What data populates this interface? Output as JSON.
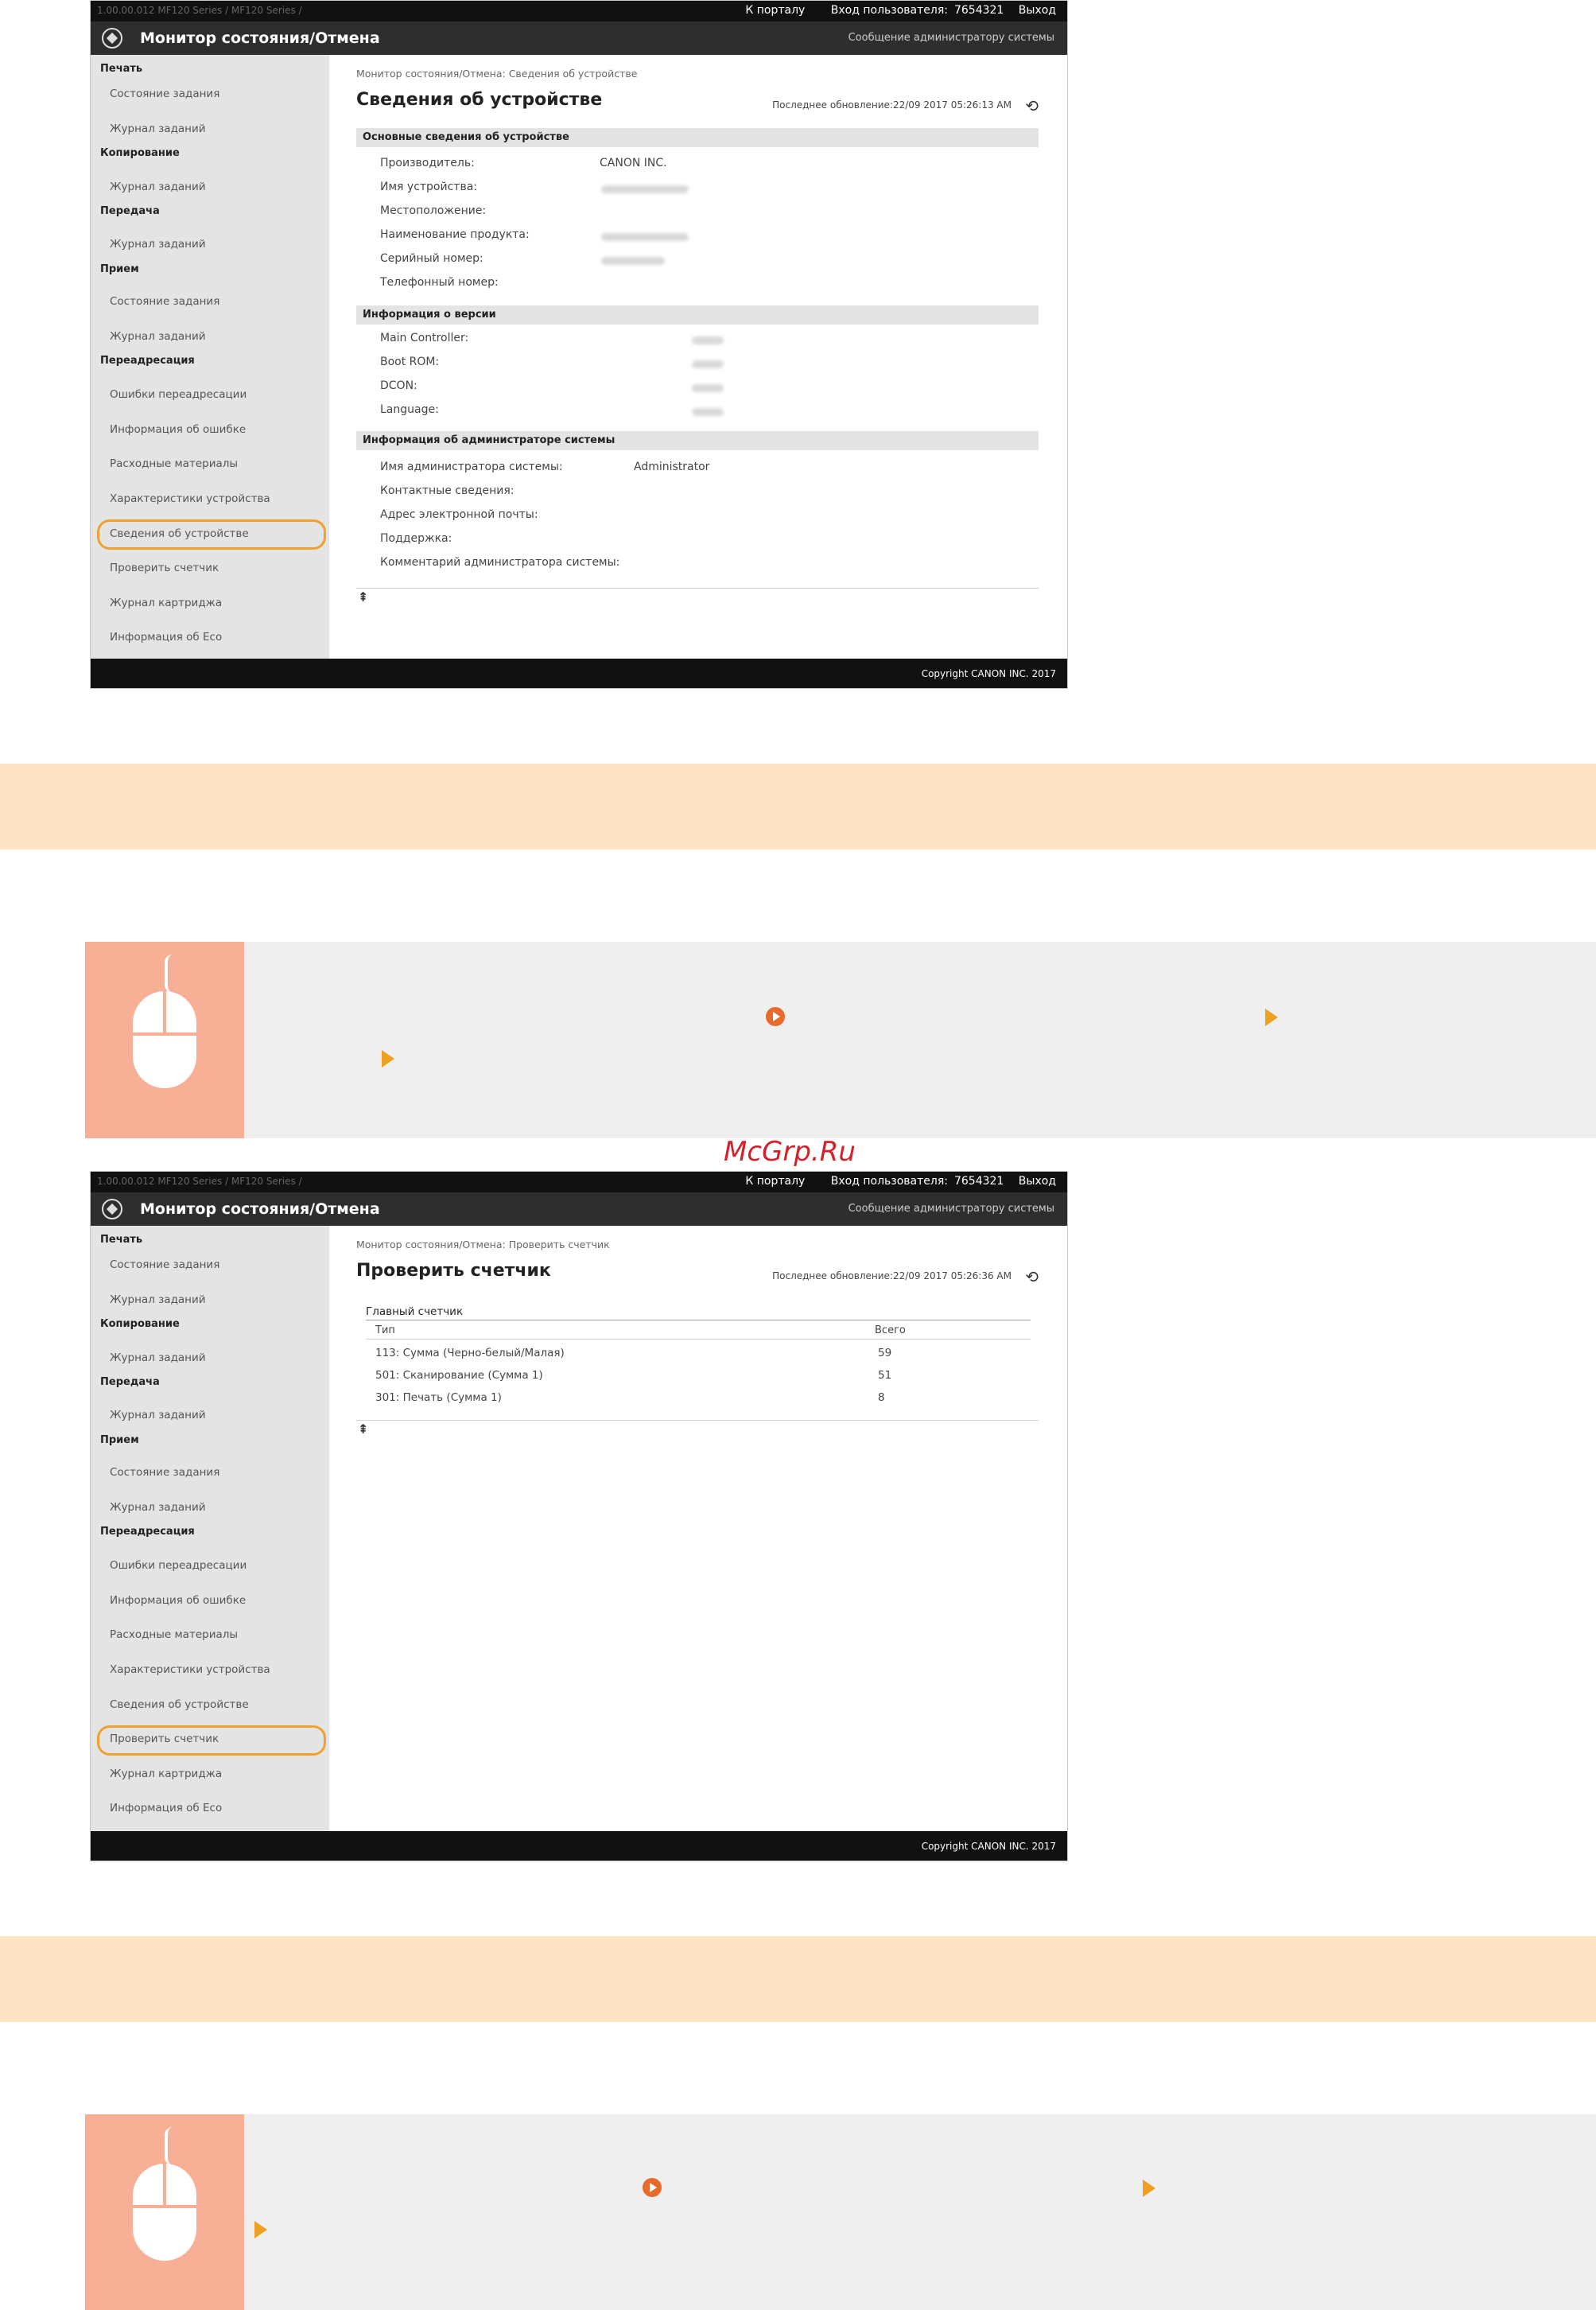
{
  "common": {
    "version_info": "1.00.00.012   MF120 Series / MF120 Series /",
    "portal_link": "К порталу",
    "login_label": "Вход пользователя:",
    "login_user": "7654321",
    "logout_link": "Выход",
    "app_title": "Монитор состояния/Отмена",
    "admin_message_link": "Сообщение администратору системы",
    "copyright": "Copyright CANON INC. 2017",
    "sidebar": {
      "group_print": "Печать",
      "job_status": "Состояние задания",
      "job_log": "Журнал заданий",
      "group_copy": "Копирование",
      "group_send": "Передача",
      "group_receive": "Прием",
      "group_forward": "Переадресация",
      "forward_errors": "Ошибки переадресации",
      "error_info": "Информация об ошибке",
      "consumables": "Расходные материалы",
      "device_features": "Характеристики устройства",
      "device_info": "Сведения об устройстве",
      "check_counter": "Проверить счетчик",
      "cartridge_log": "Журнал картриджа",
      "eco_info": "Информация об Eco"
    }
  },
  "shot1": {
    "breadcrumb": "Монитор состояния/Отмена: Сведения об устройстве",
    "page_title": "Сведения об устройстве",
    "last_updated": "Последнее обновление:22/09 2017 05:26:13 AM",
    "section_basic": "Основные сведения об устройстве",
    "manufacturer_label": "Производитель:",
    "manufacturer_value": "CANON INC.",
    "device_name_label": "Имя устройства:",
    "location_label": "Местоположение:",
    "product_name_label": "Наименование продукта:",
    "serial_label": "Серийный номер:",
    "phone_label": "Телефонный номер:",
    "section_version": "Информация о версии",
    "main_controller_label": "Main Controller:",
    "boot_rom_label": "Boot ROM:",
    "dcon_label": "DCON:",
    "language_label": "Language:",
    "section_admin": "Информация об администраторе системы",
    "admin_name_label": "Имя администратора системы:",
    "admin_name_value": "Administrator",
    "contact_label": "Контактные сведения:",
    "email_label": "Адрес электронной почты:",
    "support_label": "Поддержка:",
    "comment_label": "Комментарий администратора системы:"
  },
  "shot2": {
    "breadcrumb": "Монитор состояния/Отмена: Проверить счетчик",
    "page_title": "Проверить счетчик",
    "last_updated": "Последнее обновление:22/09 2017 05:26:36 AM",
    "section_counter": "Главный счетчик",
    "col_type": "Тип",
    "col_total": "Всего",
    "rows": [
      {
        "type": "113: Сумма (Черно-белый/Малая)",
        "total": "59"
      },
      {
        "type": "501: Сканирование (Сумма 1)",
        "total": "51"
      },
      {
        "type": "301: Печать (Сумма 1)",
        "total": "8"
      }
    ]
  },
  "watermark": "McGrp.Ru",
  "colors": {
    "banner": "#fde4c4",
    "info_bg": "#efefef",
    "icon_bg": "#f7b096",
    "highlight": "#f0a030",
    "arrow": "#f0a020",
    "circle": "#e86a2c"
  }
}
